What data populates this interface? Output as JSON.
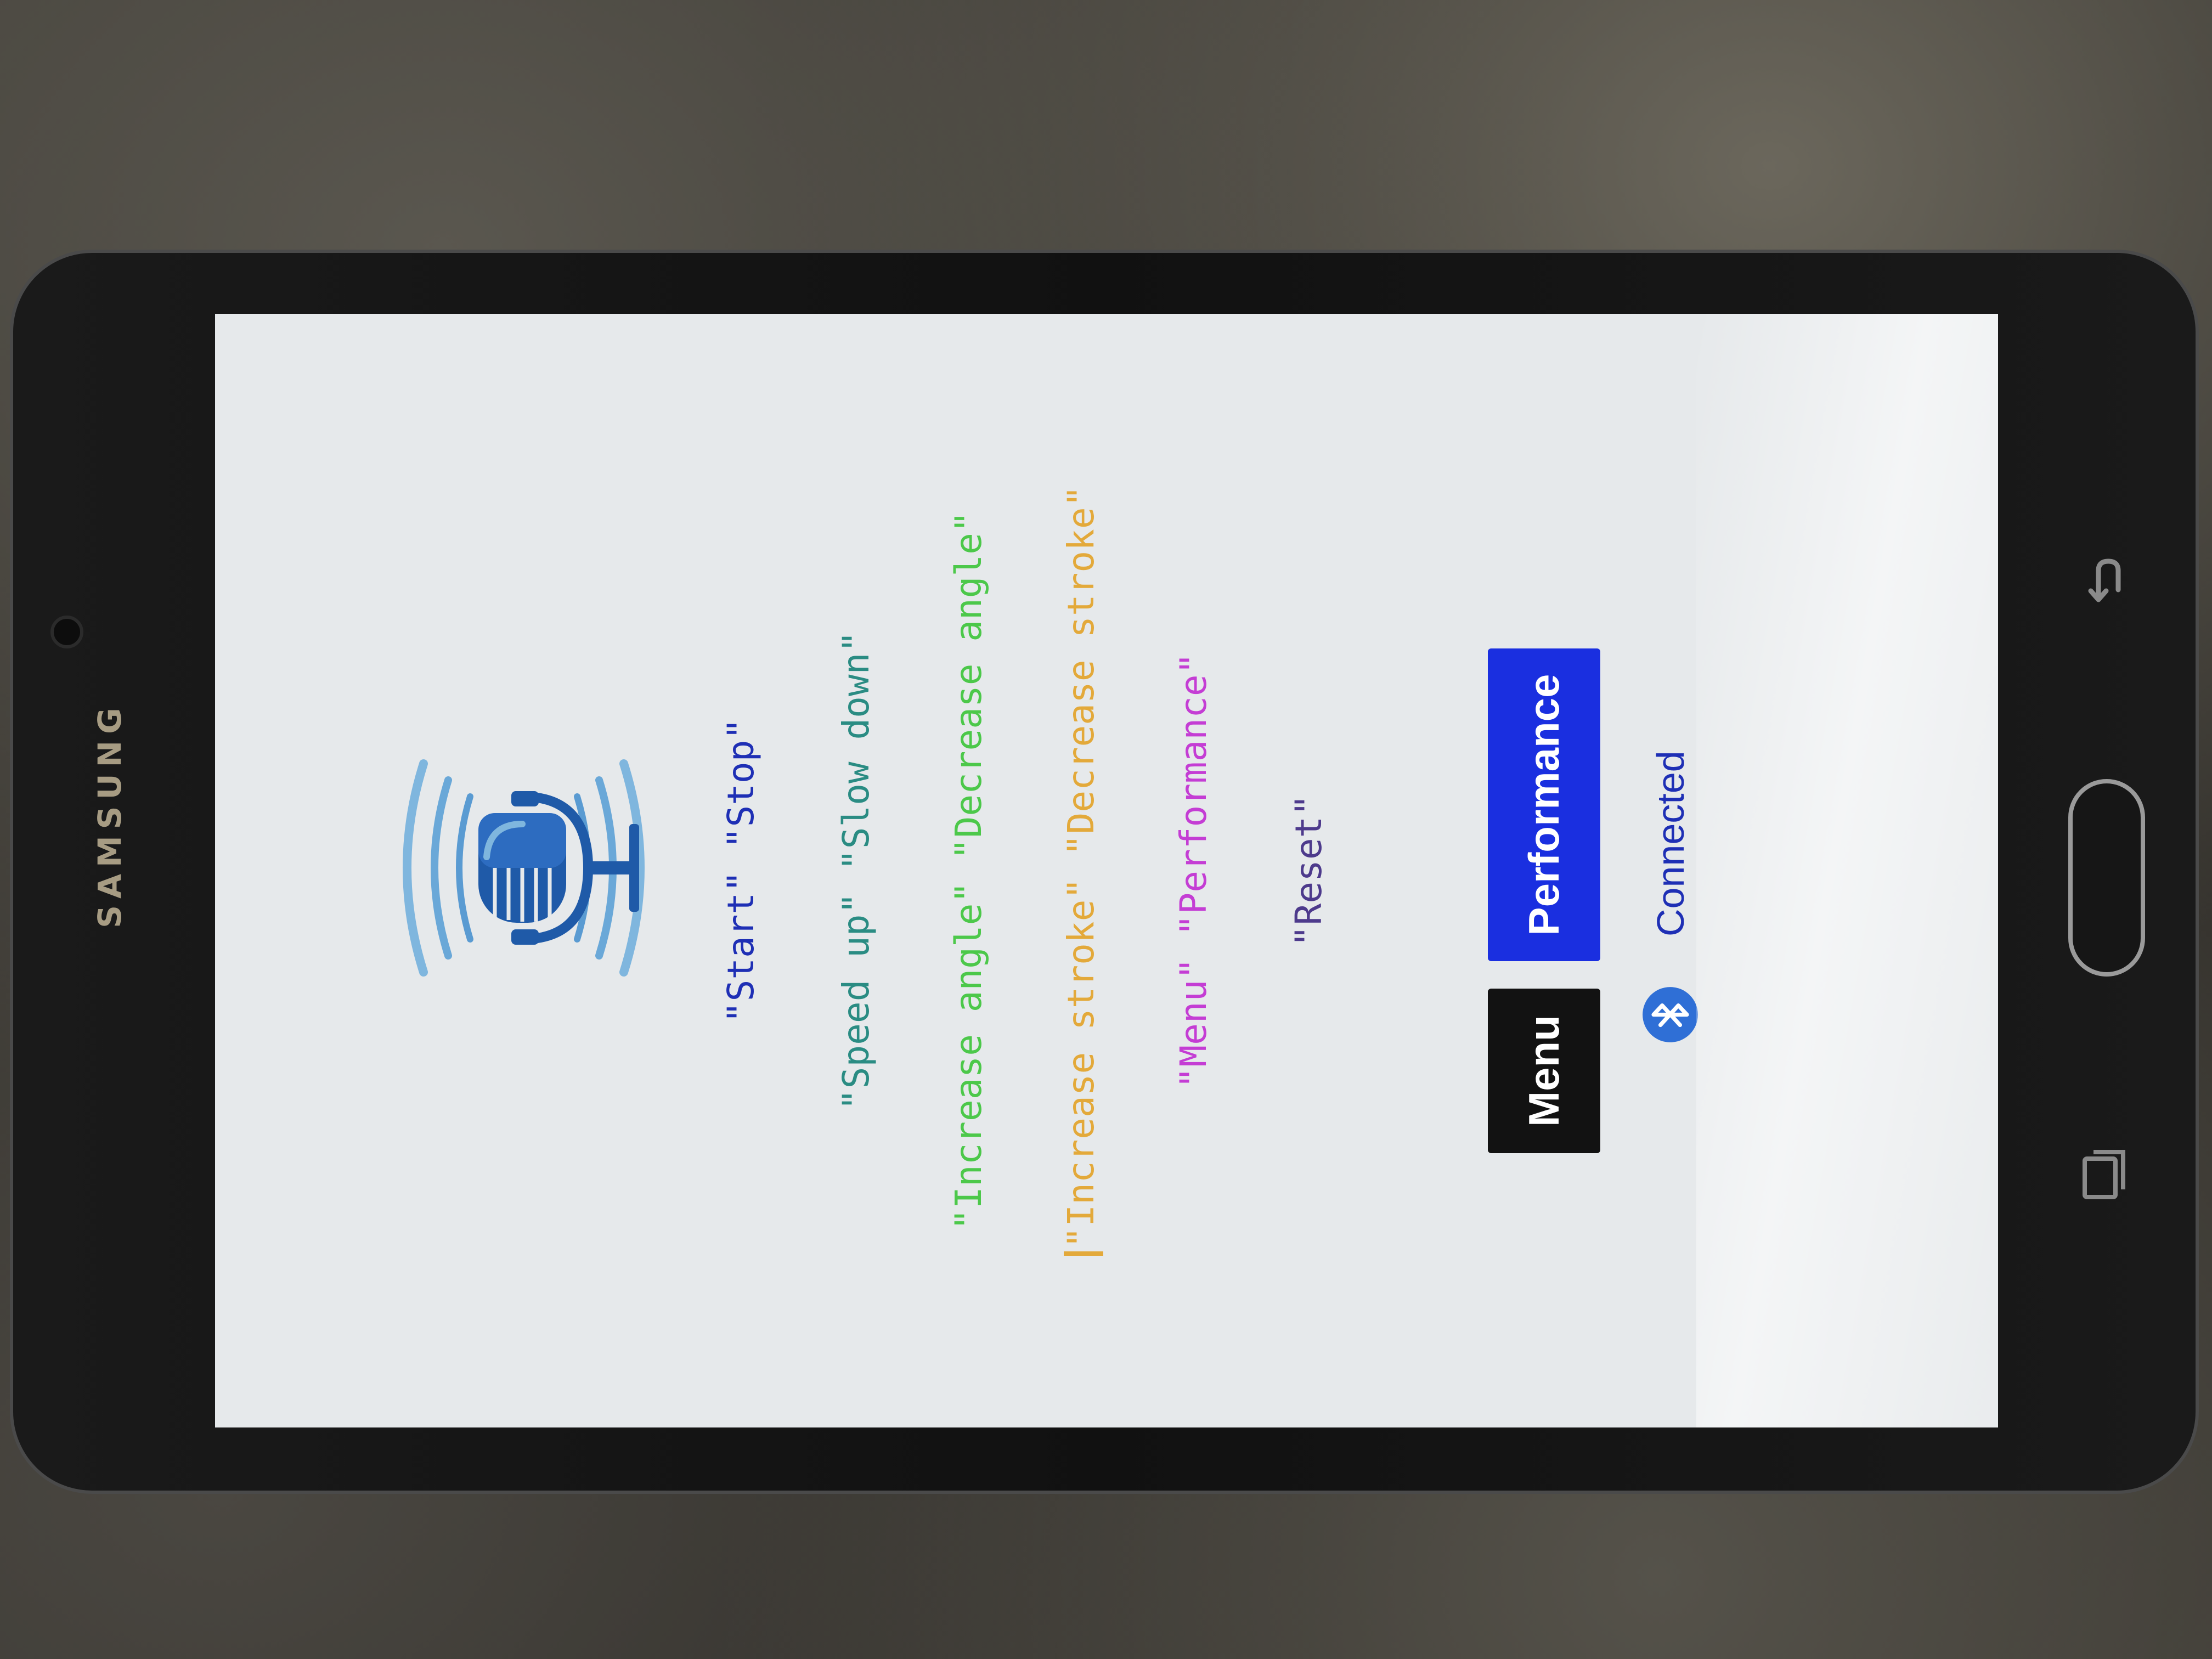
{
  "device": {
    "brand": "SAMSUNG"
  },
  "commands": {
    "start_stop": "\"Start\" \"Stop\"",
    "speed": "\"Speed up\" \"Slow down\"",
    "angle": "\"Increase angle\" \"Decrease angle\"",
    "stroke": "\"Increase stroke\" \"Decrease stroke\"",
    "menu_performance": "\"Menu\" \"Performance\"",
    "reset": "\"Reset\""
  },
  "buttons": {
    "menu_label": "Menu",
    "performance_label": "Performance"
  },
  "status": {
    "icon": "bluetooth-icon",
    "text": "Connected"
  },
  "colors": {
    "start_stop": "#1e2fb5",
    "speed": "#2a8c83",
    "angle": "#4cc84a",
    "stroke": "#e3a93a",
    "menu_performance": "#c43dd4",
    "reset": "#4d3a8c",
    "performance_button": "#1a2fe0",
    "menu_button": "#121212",
    "bluetooth": "#2f6fd6"
  },
  "icons": {
    "microphone": "microphone-icon",
    "back": "back-arrow-icon",
    "home": "home-button",
    "recent": "recent-apps-icon"
  }
}
